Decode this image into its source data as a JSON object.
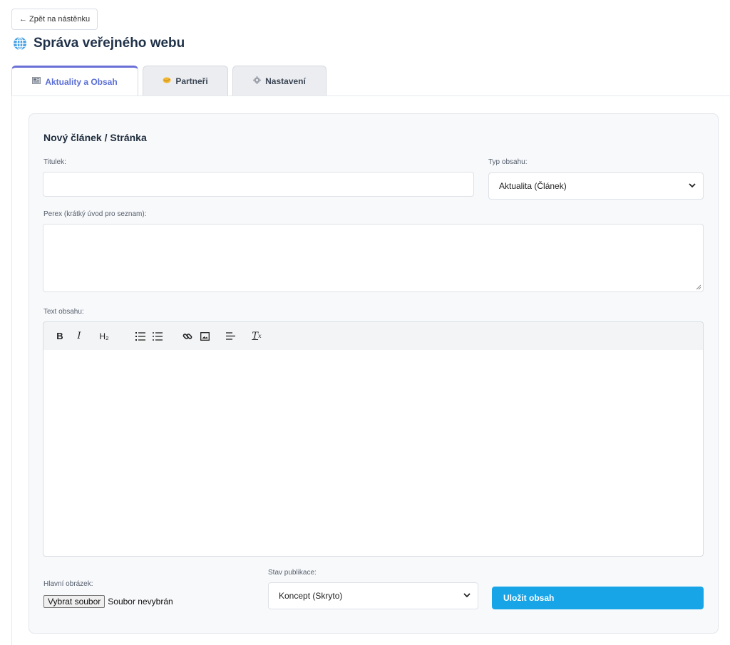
{
  "back_button": {
    "label": "← Zpět na nástěnku"
  },
  "page_title": "Správa veřejného webu",
  "tabs": [
    {
      "label": "Aktuality a Obsah",
      "icon": "newspaper-icon",
      "active": true
    },
    {
      "label": "Partneři",
      "icon": "handshake-icon",
      "active": false
    },
    {
      "label": "Nastavení",
      "icon": "gear-icon",
      "active": false
    }
  ],
  "form": {
    "heading": "Nový článek / Stránka",
    "title_label": "Titulek:",
    "title_value": "",
    "type_label": "Typ obsahu:",
    "type_value": "Aktualita (Článek)",
    "perex_label": "Perex (krátký úvod pro seznam):",
    "perex_value": "",
    "content_label": "Text obsahu:",
    "toolbar": {
      "bold": "B",
      "italic": "I",
      "heading": "H₂",
      "ordered_list": "ordered-list-icon",
      "bullet_list": "bullet-list-icon",
      "link": "link-icon",
      "image": "image-icon",
      "align": "align-icon",
      "clear_format": "Tx"
    },
    "image_label": "Hlavní obrázek:",
    "file_button": "Vybrat soubor",
    "file_status": "Soubor nevybrán",
    "status_label": "Stav publikace:",
    "status_value": "Koncept (Skryto)",
    "save_button": "Uložit obsah"
  },
  "colors": {
    "accent": "#6a6fd8",
    "primary_button": "#17a5e8",
    "title": "#1f3148"
  }
}
